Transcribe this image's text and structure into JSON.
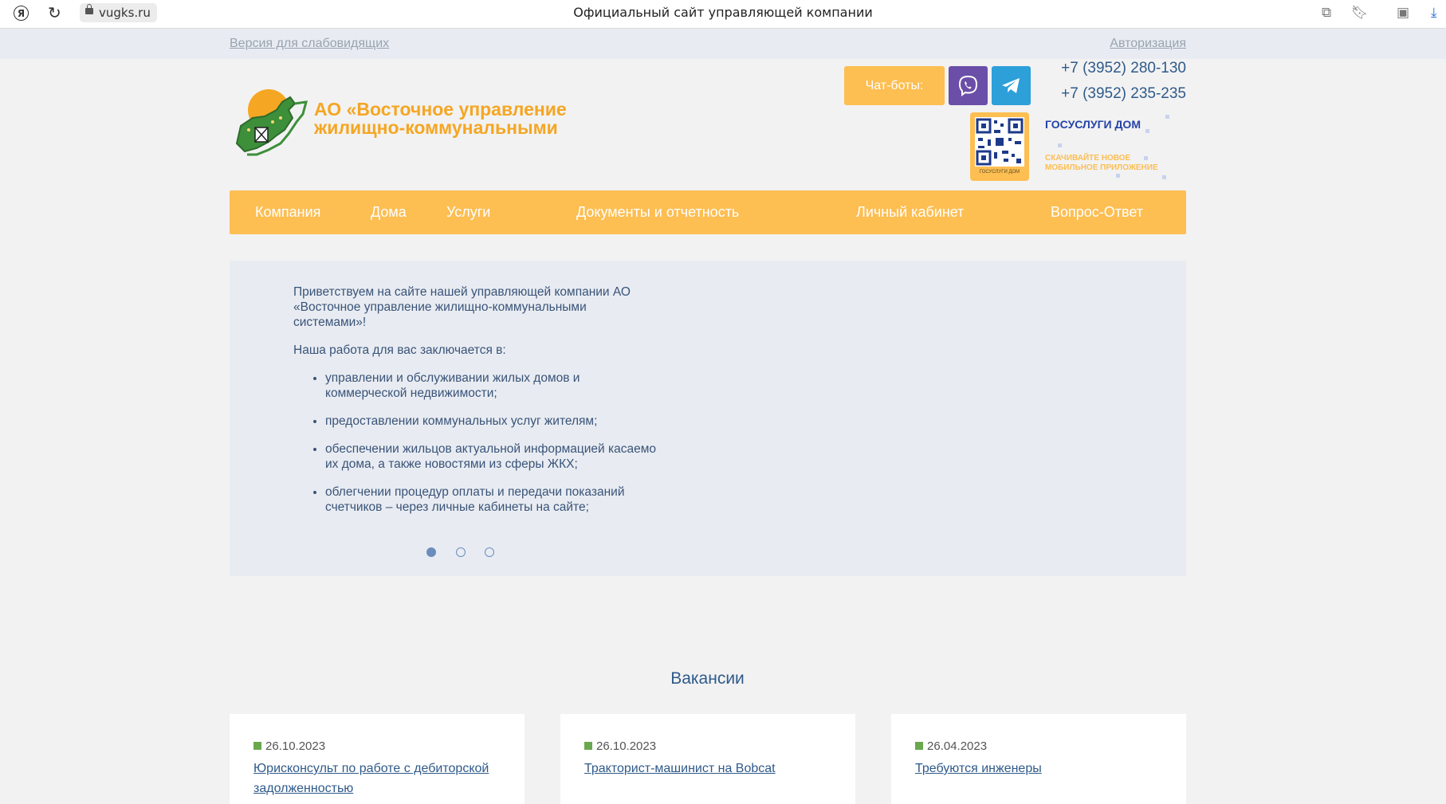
{
  "browser": {
    "url": "vugks.ru",
    "title": "Официальный сайт управляющей компании"
  },
  "utility": {
    "low_vision": "Версия для слабовидящих",
    "login": "Авторизация"
  },
  "header": {
    "company_name_line1": "АО «Восточное управление",
    "company_name_line2": "жилищно-коммунальными",
    "chatbots_label": "Чат-боты:",
    "phones": [
      "+7 (3952) 280-130",
      "+7 (3952) 235-235"
    ],
    "qr_caption": "ГОСУСЛУГИ ДОМ",
    "gosuslugi_title": "ГОСУСЛУГИ ДОМ",
    "gosuslugi_sub_line1": "СКАЧИВАЙТЕ НОВОЕ",
    "gosuslugi_sub_line2": "МОБИЛЬНОЕ ПРИЛОЖЕНИЕ",
    "brand_color": "#fdbe52"
  },
  "nav": {
    "items": [
      "Компания",
      "Дома",
      "Услуги",
      "Документы и отчетность",
      "Личный кабинет",
      "Вопрос-Ответ"
    ]
  },
  "slider": {
    "intro": "Приветствуем на сайте нашей управляющей компании АО «Восточное управление жилищно-коммунальными системами»!",
    "lead": "Наша работа для вас заключается в:",
    "bullets": [
      "управлении и обслуживании жилых домов и коммерческой недвижимости;",
      "предоставлении коммунальных услуг жителям;",
      "обеспечении жильцов актуальной информацией касаемо их дома, а также новостями из сферы ЖКХ;",
      "облегчении процедур оплаты и передачи показаний счетчиков – через личные кабинеты на сайте;"
    ],
    "active_slide": 1,
    "slide_count": 3
  },
  "vacancies": {
    "title": "Вакансии",
    "items": [
      {
        "date": "26.10.2023",
        "title": "Юрисконсульт по работе с дебиторской задолженностью"
      },
      {
        "date": "26.10.2023",
        "title": "Тракторист-машинист на Bobcat"
      },
      {
        "date": "26.04.2023",
        "title": "Требуются инженеры"
      }
    ]
  }
}
